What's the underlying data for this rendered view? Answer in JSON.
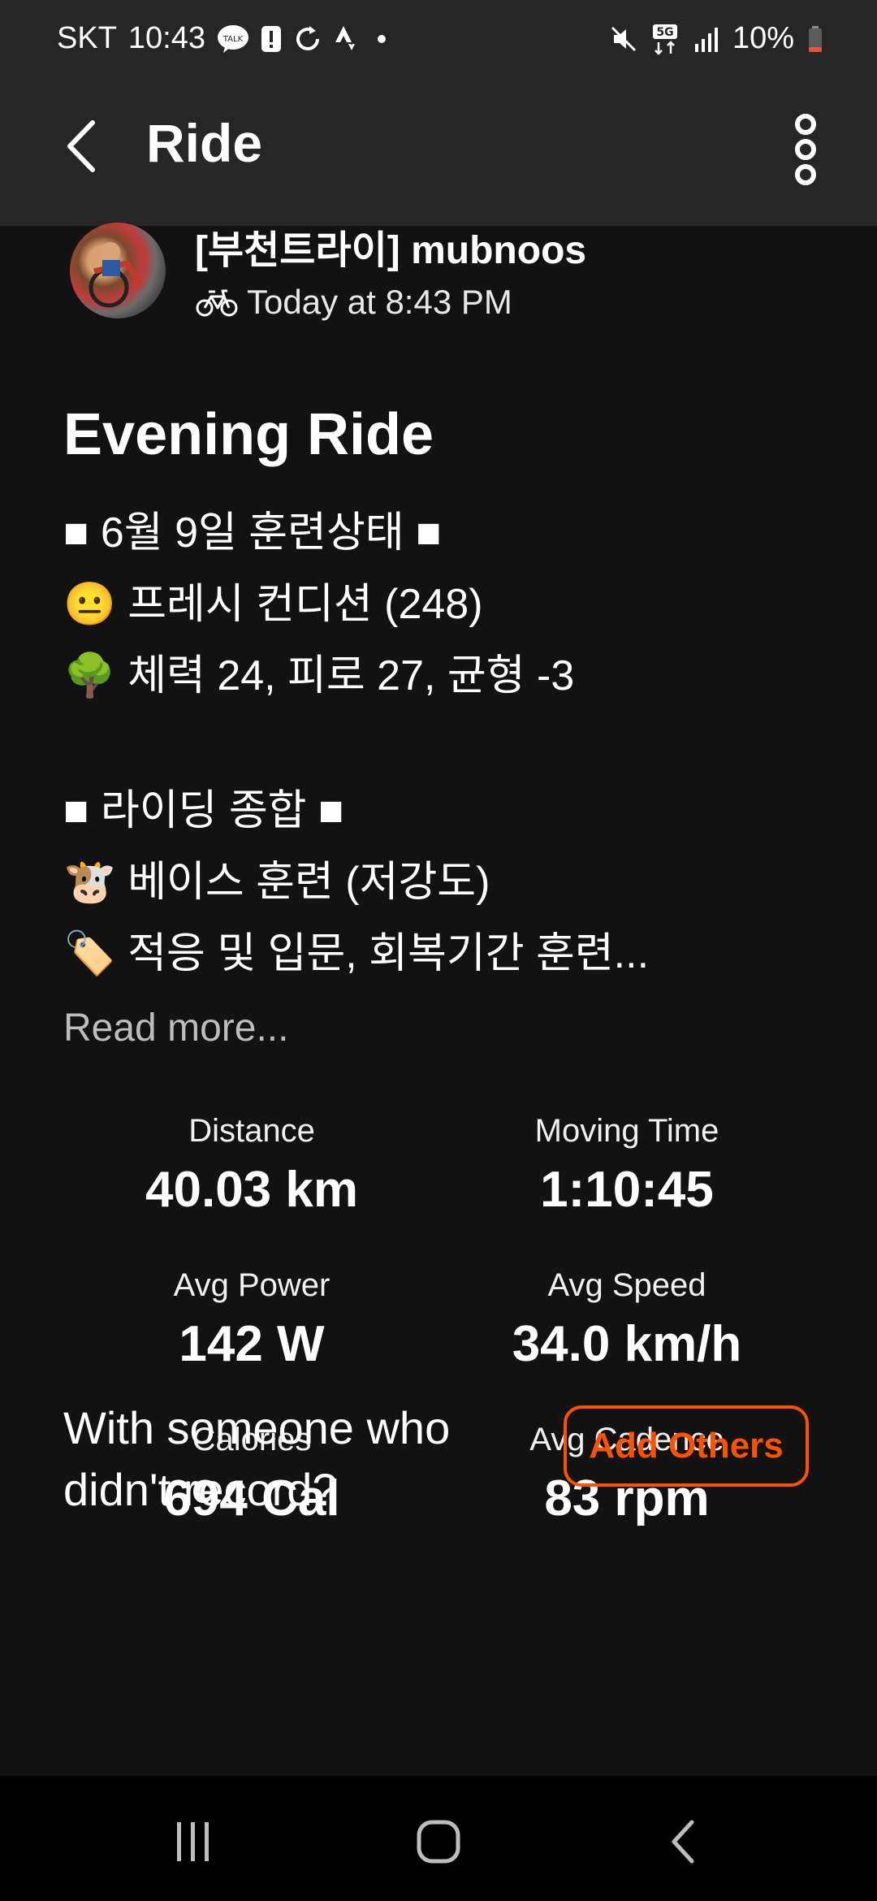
{
  "status_bar": {
    "carrier": "SKT",
    "time": "10:43",
    "talk_label": "TALK",
    "network": "5G",
    "battery": "10%",
    "icons": [
      "talk-icon",
      "alert-icon",
      "sync-icon",
      "strava-icon",
      "dot-icon",
      "mute-icon",
      "5g-icon",
      "signal-icon",
      "battery-icon"
    ]
  },
  "app_bar": {
    "title": "Ride",
    "back_icon": "chevron-left-icon",
    "more_icon": "more-vertical-icon"
  },
  "athlete": {
    "name": "[부천트라이] mubnoos",
    "activity_icon": "bike-icon",
    "timestamp": "Today at 8:43 PM"
  },
  "activity": {
    "title": "Evening Ride",
    "description_lines": [
      "■ 6월 9일 훈련상태 ■",
      "😐 프레시 컨디션 (248)",
      "🌳 체력 24, 피로 27, 균형 -3",
      "",
      "■ 라이딩 종합 ■",
      "🐮 베이스 훈련 (저강도)",
      "🏷️ 적응 및 입문, 회복기간 훈련..."
    ],
    "read_more": "Read more..."
  },
  "stats": [
    {
      "label": "Distance",
      "value": "40.03 km"
    },
    {
      "label": "Moving Time",
      "value": "1:10:45"
    },
    {
      "label": "Avg Power",
      "value": "142 W"
    },
    {
      "label": "Avg Speed",
      "value": "34.0 km/h"
    },
    {
      "label": "Calories",
      "value": "694 Cal"
    },
    {
      "label": "Avg Cadence",
      "value": "83 rpm"
    }
  ],
  "with_others": {
    "text_line1": "With someone who",
    "text_line2": "didn't record?",
    "button": "Add Others"
  },
  "colors": {
    "accent": "#fc5200",
    "background": "#121212",
    "bar": "#262626"
  },
  "nav_bar": {
    "icons": [
      "recent-apps-icon",
      "home-icon",
      "back-icon"
    ]
  }
}
